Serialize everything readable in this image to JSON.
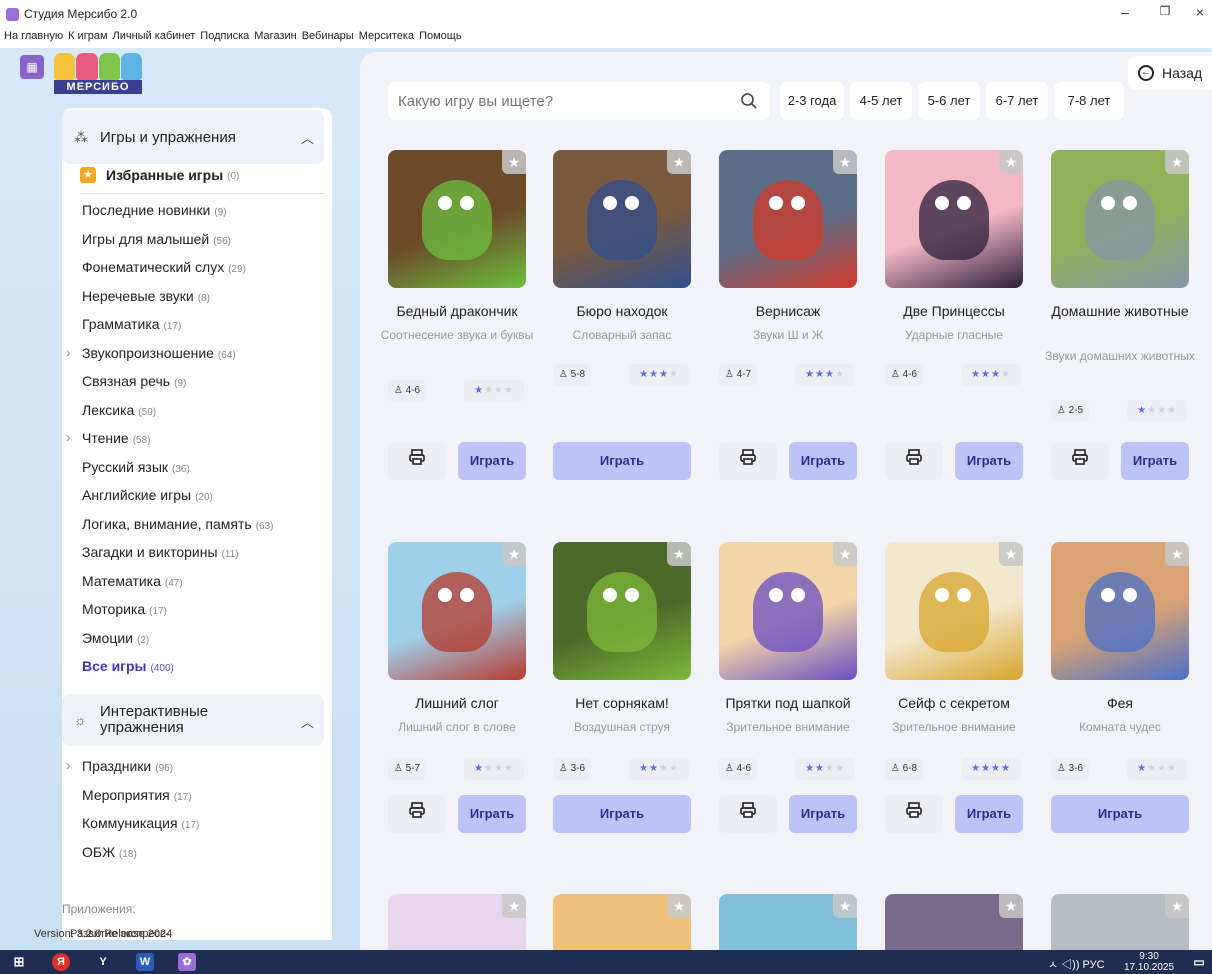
{
  "window": {
    "title": "Студия Мерсибо 2.0",
    "minimize": "–",
    "restore": "❐",
    "close": "×"
  },
  "menu": [
    "На главную",
    "К играм",
    "Личный кабинет",
    "Подписка",
    "Магазин",
    "Вебинары",
    "Мерситека",
    "Помощь"
  ],
  "logo_text": "МЕРСИБО",
  "back_label": "Назад",
  "search": {
    "placeholder": "Какую игру вы ищете?"
  },
  "ages": [
    "2-3 года",
    "4-5 лет",
    "5-6 лет",
    "6-7 лет",
    "7-8 лет"
  ],
  "sidebar": {
    "section1": "Игры и упражнения",
    "favorites": {
      "label": "Избранные игры",
      "count": "(0)"
    },
    "items": [
      {
        "label": "Последние новинки",
        "count": "(9)"
      },
      {
        "label": "Игры для малышей",
        "count": "(56)"
      },
      {
        "label": "Фонематический слух",
        "count": "(29)"
      },
      {
        "label": "Неречевые звуки",
        "count": "(8)"
      },
      {
        "label": "Грамматика",
        "count": "(17)"
      },
      {
        "label": "Звукопроизношение",
        "count": "(64)"
      },
      {
        "label": "Связная речь",
        "count": "(9)"
      },
      {
        "label": "Лексика",
        "count": "(59)"
      },
      {
        "label": "Чтение",
        "count": "(58)"
      },
      {
        "label": "Русский язык",
        "count": "(36)"
      },
      {
        "label": "Английские игры",
        "count": "(20)"
      },
      {
        "label": "Логика, внимание, память",
        "count": "(63)"
      },
      {
        "label": "Загадки и викторины",
        "count": "(11)"
      },
      {
        "label": "Математика",
        "count": "(47)"
      },
      {
        "label": "Моторика",
        "count": "(17)"
      },
      {
        "label": "Эмоции",
        "count": "(2)"
      },
      {
        "label": "Все игры",
        "count": "(400)"
      }
    ],
    "section2": "Интерактивные упражнения",
    "items2": [
      {
        "label": "Праздники",
        "count": "(96)"
      },
      {
        "label": "Мероприятия",
        "count": "(17)"
      },
      {
        "label": "Коммуникация",
        "count": "(17)"
      },
      {
        "label": "ОБЖ",
        "count": "(18)"
      }
    ],
    "apps_label": "Приложения:"
  },
  "version": "Version: 3.2.0 Release 2024",
  "version_overlap": "Развитие экспресс-",
  "play_label": "Играть",
  "games": [
    {
      "title": "Бедный дракончик",
      "sub": "Соотнесение звука и буквы",
      "age": "4-6",
      "rating": 1,
      "print": true,
      "color": "#6b4a2a",
      "accent": "#6dbf3f"
    },
    {
      "title": "Бюро находок",
      "sub": "Словарный запас",
      "age": "5-8",
      "rating": 3,
      "print": false,
      "color": "#7a5a3e",
      "accent": "#2f4f8f"
    },
    {
      "title": "Вернисаж",
      "sub": "Звуки Ш и Ж",
      "age": "4-7",
      "rating": 3,
      "print": true,
      "color": "#5a6e88",
      "accent": "#d23a2a"
    },
    {
      "title": "Две Принцессы",
      "sub": "Ударные гласные",
      "age": "4-6",
      "rating": 3,
      "print": true,
      "color": "#f4b7c6",
      "accent": "#2a1f3a"
    },
    {
      "title": "Домашние животные",
      "sub": "Звуки домашних животных",
      "age": "2-5",
      "rating": 1,
      "print": true,
      "color": "#8fb15a",
      "accent": "#8796a8"
    },
    {
      "title": "Лишний слог",
      "sub": "Лишний слог в слове",
      "age": "5-7",
      "rating": 1,
      "print": true,
      "color": "#9fd0ea",
      "accent": "#b63a2e"
    },
    {
      "title": "Нет сорнякам!",
      "sub": "Воздушная струя",
      "age": "3-6",
      "rating": 2,
      "print": false,
      "color": "#4b6a2a",
      "accent": "#7fb83a"
    },
    {
      "title": "Прятки под шапкой",
      "sub": "Зрительное внимание",
      "age": "4-6",
      "rating": 2,
      "print": true,
      "color": "#f3d6a8",
      "accent": "#6a4dc1"
    },
    {
      "title": "Сейф с секретом",
      "sub": "Зрительное внимание",
      "age": "6-8",
      "rating": 4,
      "print": true,
      "color": "#f2e8cf",
      "accent": "#d8a52b"
    },
    {
      "title": "Фея",
      "sub": "Комната чудес",
      "age": "3-6",
      "rating": 1,
      "print": false,
      "color": "#d9a373",
      "accent": "#4a6fc9"
    }
  ],
  "row3_colors": [
    "#e8d6f0",
    "#f0c07a",
    "#7fc0d8",
    "#7a6a8a",
    "#b8bcc4"
  ],
  "taskbar": {
    "tray": "ㅅ ◁)) РУС",
    "time": "9:30",
    "date": "17.10.2025"
  }
}
